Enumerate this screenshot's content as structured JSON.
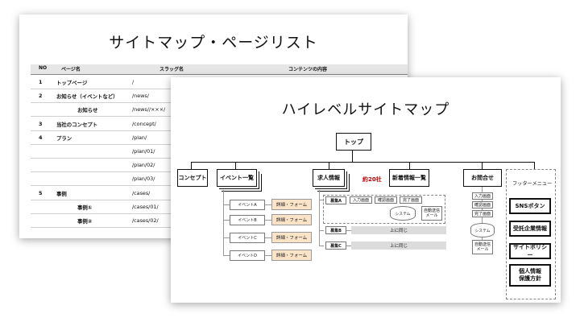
{
  "sitemap_list": {
    "title": "サイトマップ・ページリスト",
    "headers": {
      "no": "NO",
      "page": "ページ名",
      "slug": "スラッグ名",
      "content": "コンテンツの内容"
    },
    "rows": [
      {
        "no": "1",
        "name": "トップページ",
        "sub": "",
        "slug": "/"
      },
      {
        "no": "2",
        "name": "お知らせ（イベントなど）",
        "sub": "",
        "slug": "/news/"
      },
      {
        "no": "",
        "name": "",
        "sub": "お知らせ",
        "slug": "/news//×××/"
      },
      {
        "no": "3",
        "name": "当社のコンセプト",
        "sub": "",
        "slug": "/concept/"
      },
      {
        "no": "4",
        "name": "プラン",
        "sub": "",
        "slug": "/plan/"
      },
      {
        "no": "",
        "name": "",
        "sub": "",
        "slug": "/plan/01/"
      },
      {
        "no": "",
        "name": "",
        "sub": "",
        "slug": "/plan/02/"
      },
      {
        "no": "",
        "name": "",
        "sub": "",
        "slug": "/plan/03/"
      },
      {
        "no": "5",
        "name": "事例",
        "sub": "",
        "slug": "/cases/"
      },
      {
        "no": "",
        "name": "",
        "sub": "事例①",
        "slug": "/cases/01/"
      },
      {
        "no": "",
        "name": "",
        "sub": "事例②",
        "slug": "/cases/02/"
      }
    ]
  },
  "high_level": {
    "title": "ハイレベルサイトマップ",
    "top": "トップ",
    "level1": {
      "concept": "コンセプト",
      "events": "イベント一覧",
      "jobs": "求人情報",
      "news": "新着情報一覧",
      "contact": "お問合せ"
    },
    "jobs_count": "約20社",
    "footer_menu": "フッターメニュー",
    "footer_items": [
      "SNSボタン",
      "受託企業情報",
      "サイトポリシー",
      "個人情報\n保護方針"
    ],
    "event_items": [
      "イベントA",
      "イベントB",
      "イベントC",
      "イベントD"
    ],
    "event_detail": "詳細・フォーム",
    "recruit": {
      "a": "募集A",
      "b": "募集B",
      "c": "募集C"
    },
    "recruit_steps": [
      "入力画面",
      "確認画面",
      "完了画面"
    ],
    "system_label": "システム",
    "auto_mail": "自動送信\nメール",
    "same_above": "上に同じ",
    "contact_steps": [
      "入力画面",
      "確認画面",
      "完了画面"
    ]
  }
}
